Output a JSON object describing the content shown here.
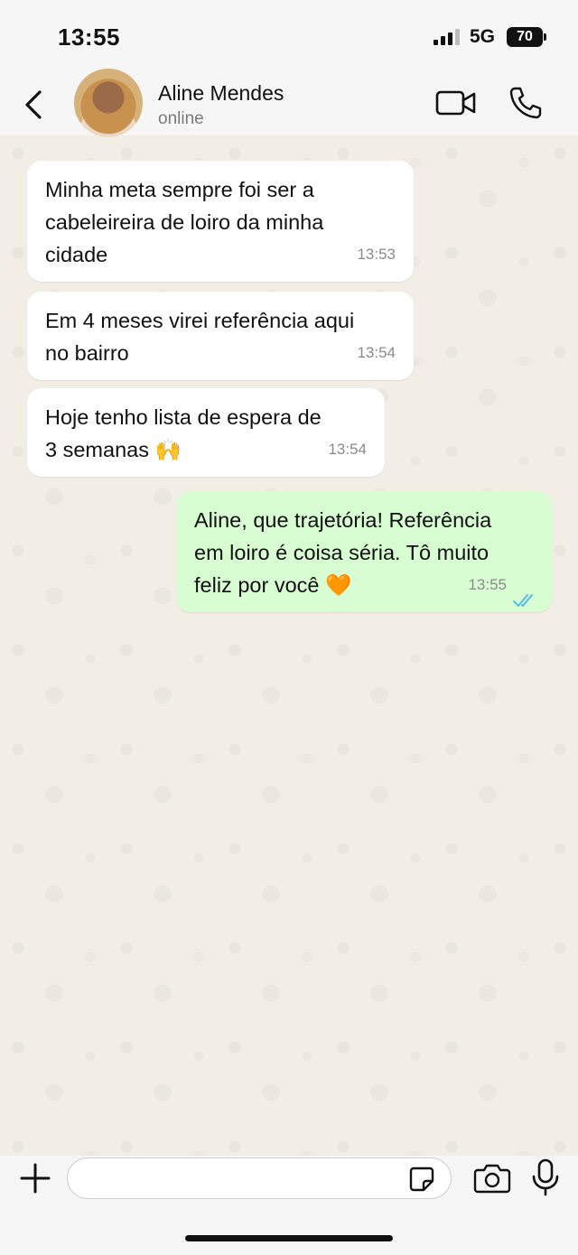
{
  "status_bar": {
    "time": "13:55",
    "network": "5G",
    "battery": "70"
  },
  "header": {
    "back_icon": "chevron-left-icon",
    "contact_name": "Aline Mendes",
    "contact_status": "online",
    "video_icon": "video-call-icon",
    "call_icon": "phone-icon"
  },
  "messages": [
    {
      "direction": "in",
      "text": "Minha meta sempre foi ser a\ncabeleireira de loiro da minha\ncidade",
      "time": "13:53"
    },
    {
      "direction": "in",
      "text": "Em 4 meses virei referência aqui\nno bairro",
      "time": "13:54"
    },
    {
      "direction": "in",
      "text": "Hoje tenho lista de espera de\n3 semanas 🙌",
      "time": "13:54"
    },
    {
      "direction": "out",
      "text": "Aline, que trajetória! Referência\nem loiro é coisa séria. Tô muito\nfeliz por você 🧡",
      "time": "13:55",
      "status": "read"
    }
  ],
  "input_bar": {
    "placeholder": "",
    "value": "",
    "icons": [
      "plus-icon",
      "sticker-icon",
      "camera-icon",
      "microphone-icon"
    ]
  },
  "colors": {
    "incoming_bubble": "#ffffff",
    "outgoing_bubble": "#d9fdd3",
    "read_ticks": "#53bdeb",
    "wallpaper": "#f2eee5"
  }
}
